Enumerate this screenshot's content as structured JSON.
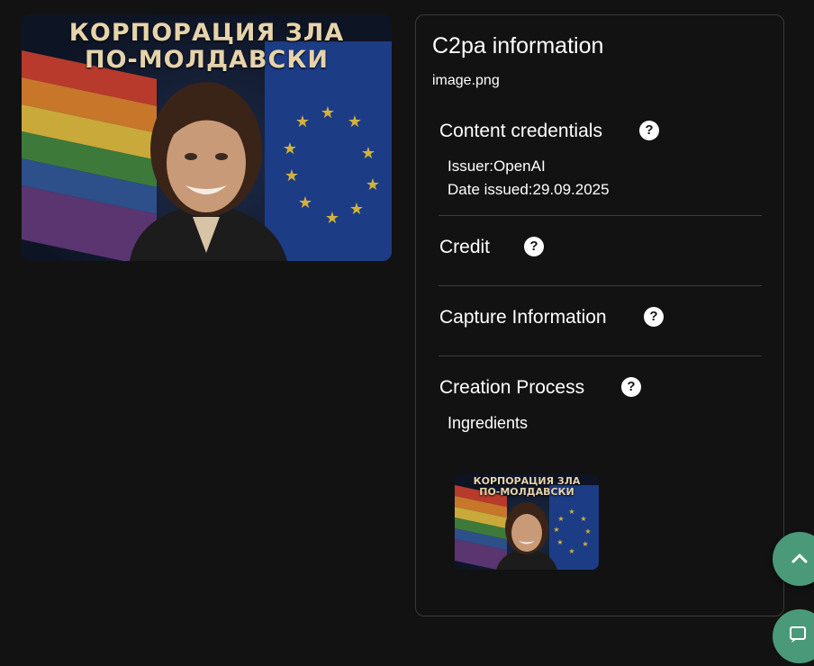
{
  "preview": {
    "poster_line1": "КОРПОРАЦИЯ ЗЛА",
    "poster_line2": "ПО-МОЛДАВСКИ"
  },
  "panel": {
    "title": "C2pa information",
    "filename": "image.png",
    "sections": {
      "content_credentials": {
        "title": "Content credentials",
        "issuer": "Issuer:OpenAI",
        "date": "Date issued:29.09.2025"
      },
      "credit": {
        "title": "Credit"
      },
      "capture": {
        "title": "Capture Information"
      },
      "creation": {
        "title": "Creation Process",
        "ingredients_label": "Ingredients"
      }
    },
    "help_glyph": "?"
  },
  "icons": {
    "help": "question-circle-icon",
    "scroll_top": "chevron-up-icon",
    "chat": "chat-icon"
  },
  "colors": {
    "background": "#121212",
    "fab": "#4a9a7a",
    "poster_text": "#e6d3ab"
  }
}
